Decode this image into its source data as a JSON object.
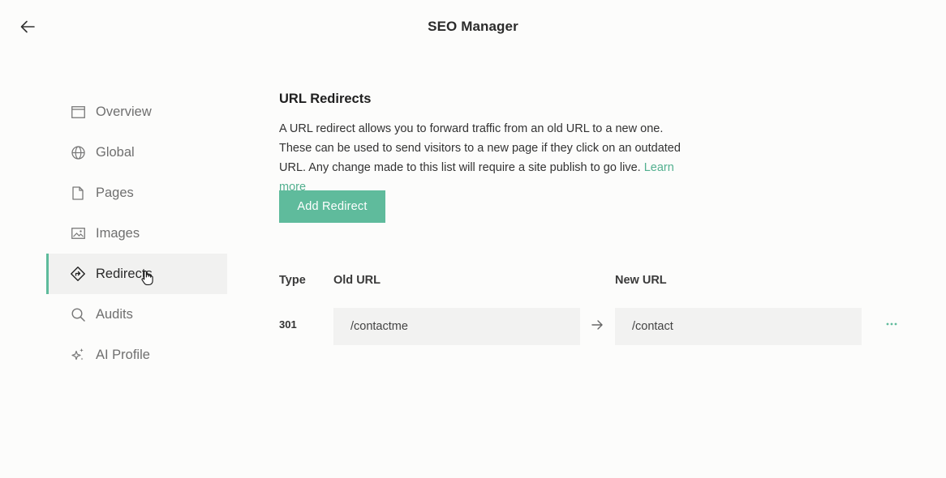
{
  "header": {
    "title": "SEO Manager"
  },
  "sidebar": {
    "items": [
      {
        "label": "Overview",
        "icon": "window-icon"
      },
      {
        "label": "Global",
        "icon": "globe-icon"
      },
      {
        "label": "Pages",
        "icon": "page-icon"
      },
      {
        "label": "Images",
        "icon": "image-icon"
      },
      {
        "label": "Redirects",
        "icon": "redirect-icon",
        "active": true
      },
      {
        "label": "Audits",
        "icon": "search-icon"
      },
      {
        "label": "AI Profile",
        "icon": "sparkle-icon"
      }
    ]
  },
  "main": {
    "section_title": "URL Redirects",
    "description": "A URL redirect allows you to forward traffic from an old URL to a new one. These can be used to send visitors to a new page if they click on an outdated URL. Any change made to this list will require a site publish to go live.",
    "learn_more": "Learn more",
    "add_button": "Add Redirect",
    "table": {
      "headers": {
        "type": "Type",
        "old_url": "Old URL",
        "new_url": "New URL"
      },
      "rows": [
        {
          "type": "301",
          "old_url": "/contactme",
          "new_url": "/contact"
        }
      ]
    }
  },
  "colors": {
    "accent": "#5fbb9c",
    "link": "#52b08f",
    "background": "#fcfcfb"
  }
}
